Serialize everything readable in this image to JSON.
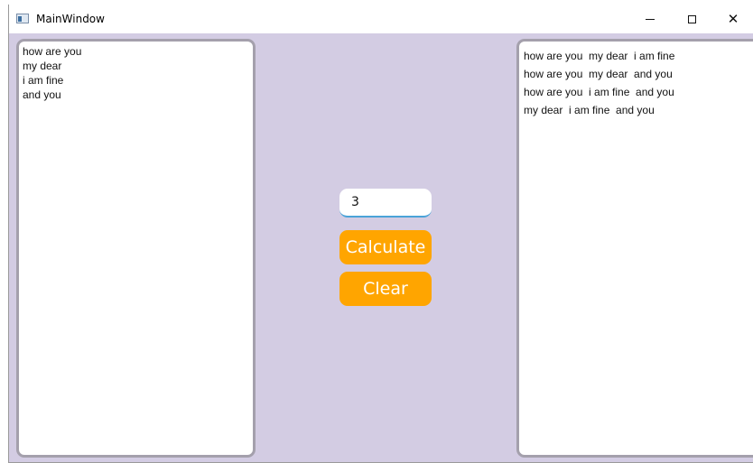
{
  "window": {
    "title": "MainWindow"
  },
  "input_lines": [
    "how are you",
    "my dear",
    "i am fine",
    "and you"
  ],
  "number_input": {
    "value": "3"
  },
  "buttons": {
    "calculate": "Calculate",
    "clear": "Clear"
  },
  "output_lines": [
    "how are you  my dear  i am fine",
    "how are you  my dear  and you",
    "how are you  i am fine  and you",
    "my dear  i am fine  and you"
  ],
  "colors": {
    "background": "#d3cce3",
    "button": "#ffa500",
    "input_underline": "#4aa3d8"
  }
}
